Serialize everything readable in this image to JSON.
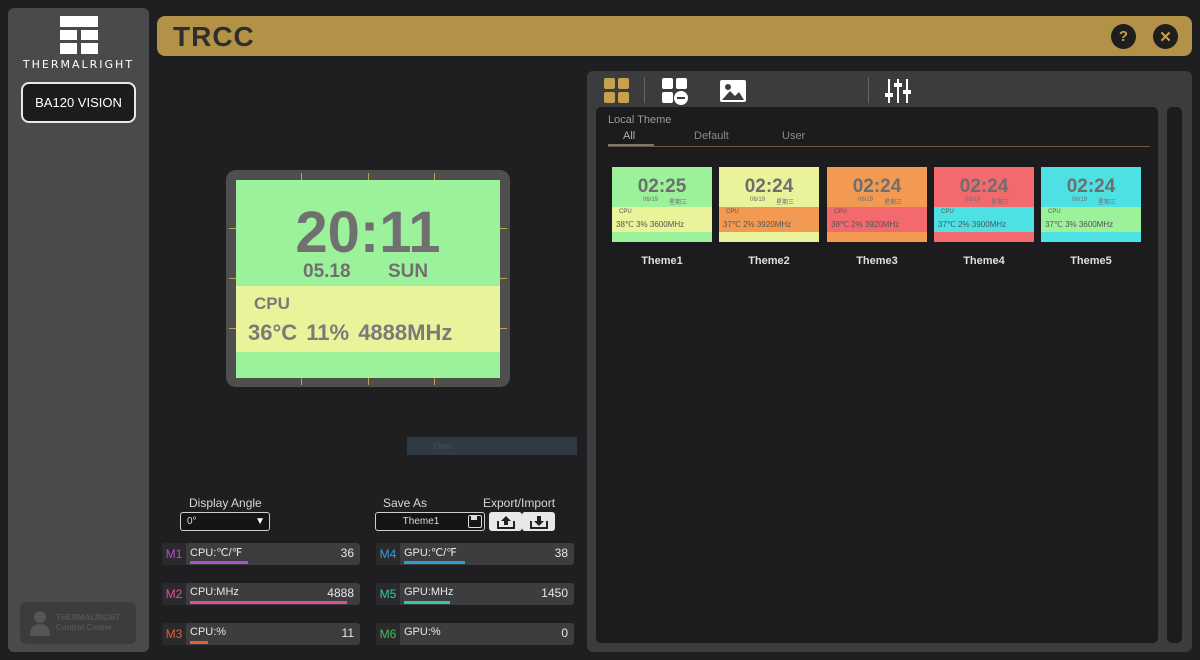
{
  "sidebar": {
    "logo_text": "THERMALRIGHT",
    "device_label": "BA120 VISION",
    "footer_brand_line1": "THERMALRIGHT",
    "footer_brand_line2": "Control Center"
  },
  "header": {
    "title": "TRCC",
    "help_label": "?",
    "close_label": "✕"
  },
  "preview": {
    "time": "20:11",
    "date": "05.18",
    "day": "SUN",
    "cpu_label": "CPU",
    "cpu_stats": "36°C  11%  4888MHz",
    "background_color": "#9cf19b",
    "panel_color": "#eaf29a"
  },
  "overlay_bar": {
    "text": "Ovec"
  },
  "controls": {
    "display_angle_label": "Display Angle",
    "display_angle_value": "0°",
    "save_as_label": "Save As",
    "save_as_value": "Theme1",
    "export_import_label": "Export/Import"
  },
  "metrics": [
    {
      "tag": "M1",
      "label": "CPU:℃/℉",
      "value": "36",
      "color": "#b050d0",
      "level": 0.36
    },
    {
      "tag": "M2",
      "label": "CPU:MHz",
      "value": "4888",
      "color": "#e0509a",
      "level": 0.98
    },
    {
      "tag": "M3",
      "label": "CPU:%",
      "value": "11",
      "color": "#e06040",
      "level": 0.11
    },
    {
      "tag": "M4",
      "label": "GPU:℃/℉",
      "value": "38",
      "color": "#2a9fd6",
      "level": 0.38
    },
    {
      "tag": "M5",
      "label": "GPU:MHz",
      "value": "1450",
      "color": "#30c8a8",
      "level": 0.29
    },
    {
      "tag": "M6",
      "label": "GPU:%",
      "value": "0",
      "color": "#40c060",
      "level": 0.0
    }
  ],
  "theme_panel": {
    "local_theme_label": "Local Theme",
    "tabs": [
      "All",
      "Default",
      "User"
    ],
    "themes": [
      {
        "name": "Theme1",
        "time": "02:25",
        "date": "06/19",
        "day": "星期三",
        "cpu_label": "CPU",
        "stats": "38℃  3%  3600MHz",
        "top_color": "#9cf19b",
        "panel_color": "#eaf29a",
        "bottom_color": "#9cf19b"
      },
      {
        "name": "Theme2",
        "time": "02:24",
        "date": "06/19",
        "day": "星期三",
        "cpu_label": "CPU",
        "stats": "37℃  2%  3920MHz",
        "top_color": "#eaf29a",
        "panel_color": "#f39a52",
        "bottom_color": "#eaf29a"
      },
      {
        "name": "Theme3",
        "time": "02:24",
        "date": "06/19",
        "day": "星期三",
        "cpu_label": "CPU",
        "stats": "38℃  2%  3920MHz",
        "top_color": "#f39a52",
        "panel_color": "#f2696e",
        "bottom_color": "#f39a52"
      },
      {
        "name": "Theme4",
        "time": "02:24",
        "date": "06/19",
        "day": "星期三",
        "cpu_label": "CPU",
        "stats": "37℃  2%  3900MHz",
        "top_color": "#f2696e",
        "panel_color": "#4ee1e4",
        "bottom_color": "#f2696e"
      },
      {
        "name": "Theme5",
        "time": "02:24",
        "date": "06/19",
        "day": "星期三",
        "cpu_label": "CPU",
        "stats": "37℃  3%  3600MHz",
        "top_color": "#4ee1e4",
        "panel_color": "#9cf19b",
        "bottom_color": "#4ee1e4"
      }
    ]
  },
  "colors": {
    "accent": "#b39146",
    "sidebar": "#4a4a4c",
    "background": "#1f1f21"
  }
}
